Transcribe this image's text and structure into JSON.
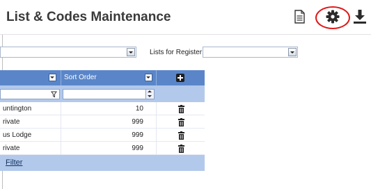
{
  "header": {
    "title": "List & Codes Maintenance",
    "icons": [
      "document-icon",
      "gear-icon",
      "download-icon"
    ]
  },
  "filters": {
    "lists_for_register_label": "Lists for Register:",
    "first_select_value": "",
    "register_select_value": ""
  },
  "grid": {
    "columns": [
      {
        "label": ""
      },
      {
        "label": "Sort Order"
      }
    ],
    "add_icon": "plus-icon",
    "rows": [
      {
        "name": "untington",
        "sort": "10"
      },
      {
        "name": "rivate",
        "sort": "999"
      },
      {
        "name": "us Lodge",
        "sort": "999"
      },
      {
        "name": "rivate",
        "sort": "999"
      }
    ],
    "footer_link": "Filter"
  }
}
